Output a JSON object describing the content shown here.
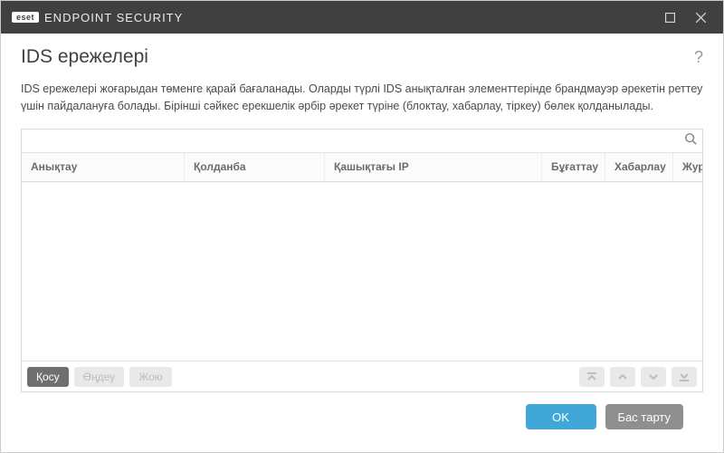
{
  "titlebar": {
    "brand_badge": "eset",
    "brand_text": "ENDPOINT SECURITY"
  },
  "page": {
    "heading": "IDS ережелері",
    "description": "IDS ережелері жоғарыдан төменге қарай бағаланады. Оларды түрлі IDS анықталған элементтерінде брандмауэр әрекетін реттеу үшін пайдалануға болады. Бірінші сәйкес ерекшелік әрбір әрекет түріне (блоктау, хабарлау, тіркеу) бөлек қолданылады."
  },
  "search": {
    "placeholder": ""
  },
  "columns": [
    "Анықтау",
    "Қолданба",
    "Қашықтағы IP",
    "Бұғаттау",
    "Хабарлау",
    "Журнал"
  ],
  "toolbar": {
    "add": "Қосу",
    "edit": "Өңдеу",
    "delete": "Жою"
  },
  "footer": {
    "ok": "OK",
    "cancel": "Бас тарту"
  }
}
